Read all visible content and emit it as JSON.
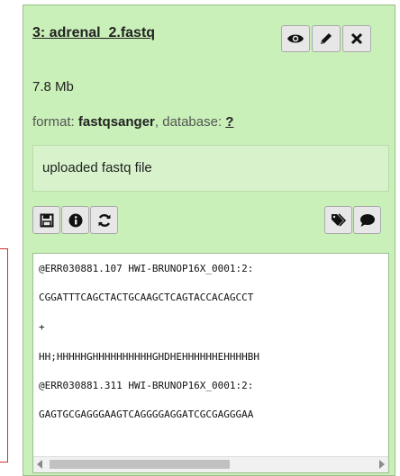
{
  "dataset": {
    "title": "3: adrenal_2.fastq",
    "size": "7.8 Mb",
    "format_prefix": "format: ",
    "format_value": "fastqsanger",
    "database_prefix": ", database: ",
    "database_value": "?",
    "info": "uploaded fastq file"
  },
  "peek": {
    "lines": [
      "@ERR030881.107 HWI-BRUNOP16X_0001:2:",
      "CGGATTTCAGCTACTGCAAGCTCAGTACCACAGCCT",
      "+",
      "HH;HHHHHGHHHHHHHHHHGHDHEHHHHHHEHHHHBH",
      "@ERR030881.311 HWI-BRUNOP16X_0001:2:",
      "GAGTGCGAGGGAAGTCAGGGGAGGATCGCGAGGGAA"
    ]
  },
  "icons": {
    "view": "eye-icon",
    "edit": "pencil-icon",
    "delete": "close-icon",
    "save": "save-icon",
    "info": "info-icon",
    "rerun": "refresh-icon",
    "tags": "tags-icon",
    "comments": "comment-icon"
  },
  "colors": {
    "panel_bg": "#c9f0b8",
    "accent_red": "#d32f2f"
  }
}
